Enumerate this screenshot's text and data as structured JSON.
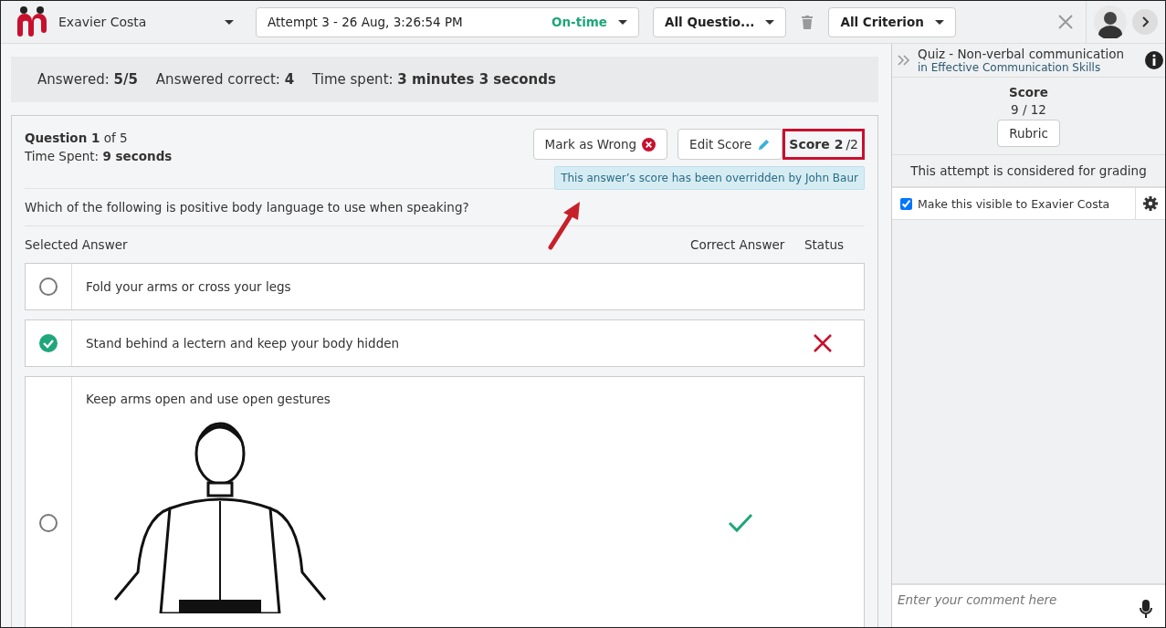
{
  "header": {
    "student": "Exavier Costa",
    "attempt": {
      "label": "Attempt 3 - 26 Aug, 3:26:54 PM",
      "status": "On-time"
    },
    "filters": [
      "All Questio...",
      "All Criterion"
    ]
  },
  "summary": [
    {
      "label": "Answered:",
      "value": "5/5"
    },
    {
      "label": "Answered correct:",
      "value": "4"
    },
    {
      "label": "Time spent:",
      "value": "3 minutes 3 seconds"
    }
  ],
  "question": {
    "title": "Question",
    "number": "1",
    "of": "of 5",
    "time_label": "Time Spent:",
    "time": "9 seconds",
    "mark_wrong": "Mark as Wrong",
    "edit_score": "Edit Score",
    "score": "Score 2",
    "score_total": "/2",
    "notice": "This answer’s score has been overridden by John Baur",
    "prompt": "Which of the following is positive body language to use when speaking?",
    "columns": [
      "Selected Answer",
      "Correct Answer",
      "Status"
    ],
    "answers": [
      {
        "text": "Fold your arms or cross your legs",
        "kind": "text",
        "selected": false,
        "correct": false,
        "wrong": false
      },
      {
        "text": "Stand behind a lectern and keep your body hidden",
        "kind": "text",
        "selected": true,
        "correct": false,
        "wrong": true
      },
      {
        "text": "Keep arms open and use open gestures",
        "kind": "picture",
        "selected": false,
        "correct": true,
        "wrong": false
      }
    ]
  },
  "panel": {
    "title": "Quiz - Non-verbal communication",
    "course": "in Effective Communication Skills",
    "score_label": "Score",
    "score": "9 / 12",
    "rubric": "Rubric",
    "grading_note": "This attempt is considered for grading",
    "visible": {
      "label": "Make this visible to Exavier Costa",
      "checked": true
    },
    "comment": {
      "placeholder": "Enter your comment here"
    }
  }
}
